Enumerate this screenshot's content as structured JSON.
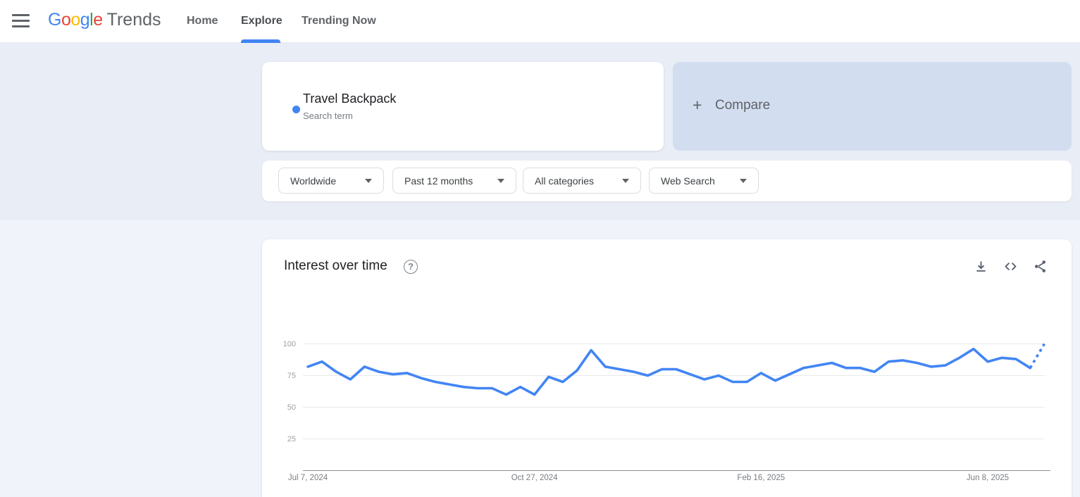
{
  "header": {
    "logo": {
      "letters": [
        {
          "ch": "G",
          "color": "#4285F4"
        },
        {
          "ch": "o",
          "color": "#EA4335"
        },
        {
          "ch": "o",
          "color": "#FBBC05"
        },
        {
          "ch": "g",
          "color": "#4285F4"
        },
        {
          "ch": "l",
          "color": "#34A853"
        },
        {
          "ch": "e",
          "color": "#EA4335"
        }
      ],
      "product": "Trends"
    },
    "nav": [
      {
        "label": "Home",
        "active": false
      },
      {
        "label": "Explore",
        "active": true
      },
      {
        "label": "Trending Now",
        "active": false
      }
    ]
  },
  "term_card": {
    "title": "Travel Backpack",
    "subtitle": "Search term",
    "dot_color": "#4285f4"
  },
  "compare_card": {
    "plus": "+",
    "label": "Compare",
    "background": "#d2ddf0"
  },
  "filters": [
    {
      "label": "Worldwide"
    },
    {
      "label": "Past 12 months"
    },
    {
      "label": "All categories"
    },
    {
      "label": "Web Search"
    }
  ],
  "chart_section": {
    "title": "Interest over time",
    "help_glyph": "?",
    "icons": [
      "download-icon",
      "embed-icon",
      "share-icon"
    ]
  },
  "chart_data": {
    "type": "line",
    "title": "Interest over time",
    "xlabel": "",
    "ylabel": "",
    "ylim": [
      0,
      100
    ],
    "grid": true,
    "legend_position": "none",
    "line_color": "#4285f4",
    "y_ticks": [
      100,
      75,
      50,
      25
    ],
    "x_tick_labels": [
      "Jul 7, 2024",
      "Oct 27, 2024",
      "Feb 16, 2025",
      "Jun 8, 2025"
    ],
    "x_tick_indices": [
      0,
      16,
      32,
      48
    ],
    "note": "weekly values; final point is partial data drawn dotted",
    "series": [
      {
        "name": "Travel Backpack",
        "values": [
          82,
          86,
          78,
          72,
          82,
          78,
          76,
          77,
          73,
          70,
          68,
          66,
          65,
          65,
          60,
          66,
          60,
          74,
          70,
          79,
          95,
          82,
          80,
          78,
          75,
          80,
          80,
          76,
          72,
          75,
          70,
          70,
          77,
          71,
          76,
          81,
          83,
          85,
          81,
          81,
          78,
          86,
          87,
          85,
          82,
          83,
          89,
          96,
          86,
          89,
          88,
          81,
          100
        ],
        "partial_last_point": true
      }
    ]
  }
}
